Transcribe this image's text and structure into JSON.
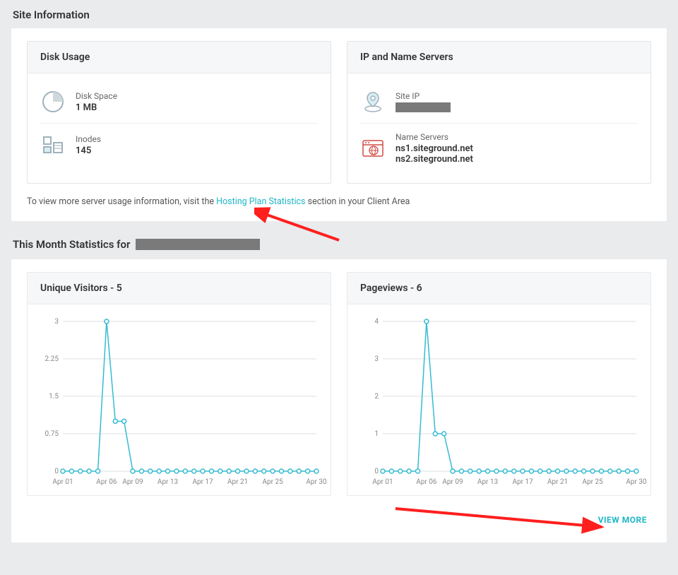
{
  "site_info": {
    "title": "Site Information",
    "disk_usage": {
      "header": "Disk Usage",
      "disk_space": {
        "label": "Disk Space",
        "value": "1 MB"
      },
      "inodes": {
        "label": "Inodes",
        "value": "145"
      }
    },
    "ip_ns": {
      "header": "IP and Name Servers",
      "site_ip": {
        "label": "Site IP"
      },
      "name_servers": {
        "label": "Name Servers",
        "ns1": "ns1.siteground.net",
        "ns2": "ns2.siteground.net"
      }
    },
    "helper": {
      "prefix": "To view more server usage information, visit the ",
      "link": "Hosting Plan Statistics",
      "suffix": " section in your Client Area"
    }
  },
  "month_stats": {
    "title_prefix": "This Month Statistics for ",
    "visitors": {
      "header": "Unique Visitors - 5"
    },
    "pageviews": {
      "header": "Pageviews - 6"
    },
    "view_more": "VIEW MORE"
  },
  "chart_data": [
    {
      "type": "line",
      "title": "Unique Visitors - 5",
      "xlabel": "",
      "ylabel": "",
      "ylim": [
        0,
        3
      ],
      "x_ticks": [
        "Apr 01",
        "Apr 06",
        "Apr 09",
        "Apr 13",
        "Apr 17",
        "Apr 21",
        "Apr 25",
        "Apr 30"
      ],
      "y_ticks": [
        0,
        0.75,
        1.5,
        2.25,
        3
      ],
      "categories": [
        "Apr 01",
        "Apr 02",
        "Apr 03",
        "Apr 04",
        "Apr 05",
        "Apr 06",
        "Apr 07",
        "Apr 08",
        "Apr 09",
        "Apr 10",
        "Apr 11",
        "Apr 12",
        "Apr 13",
        "Apr 14",
        "Apr 15",
        "Apr 16",
        "Apr 17",
        "Apr 18",
        "Apr 19",
        "Apr 20",
        "Apr 21",
        "Apr 22",
        "Apr 23",
        "Apr 24",
        "Apr 25",
        "Apr 26",
        "Apr 27",
        "Apr 28",
        "Apr 29",
        "Apr 30"
      ],
      "values": [
        0,
        0,
        0,
        0,
        0,
        3,
        1,
        1,
        0,
        0,
        0,
        0,
        0,
        0,
        0,
        0,
        0,
        0,
        0,
        0,
        0,
        0,
        0,
        0,
        0,
        0,
        0,
        0,
        0,
        0
      ]
    },
    {
      "type": "line",
      "title": "Pageviews - 6",
      "xlabel": "",
      "ylabel": "",
      "ylim": [
        0,
        4
      ],
      "x_ticks": [
        "Apr 01",
        "Apr 06",
        "Apr 09",
        "Apr 13",
        "Apr 17",
        "Apr 21",
        "Apr 25",
        "Apr 30"
      ],
      "y_ticks": [
        0,
        1,
        2,
        3,
        4
      ],
      "categories": [
        "Apr 01",
        "Apr 02",
        "Apr 03",
        "Apr 04",
        "Apr 05",
        "Apr 06",
        "Apr 07",
        "Apr 08",
        "Apr 09",
        "Apr 10",
        "Apr 11",
        "Apr 12",
        "Apr 13",
        "Apr 14",
        "Apr 15",
        "Apr 16",
        "Apr 17",
        "Apr 18",
        "Apr 19",
        "Apr 20",
        "Apr 21",
        "Apr 22",
        "Apr 23",
        "Apr 24",
        "Apr 25",
        "Apr 26",
        "Apr 27",
        "Apr 28",
        "Apr 29",
        "Apr 30"
      ],
      "values": [
        0,
        0,
        0,
        0,
        0,
        4,
        1,
        1,
        0,
        0,
        0,
        0,
        0,
        0,
        0,
        0,
        0,
        0,
        0,
        0,
        0,
        0,
        0,
        0,
        0,
        0,
        0,
        0,
        0,
        0
      ]
    }
  ]
}
